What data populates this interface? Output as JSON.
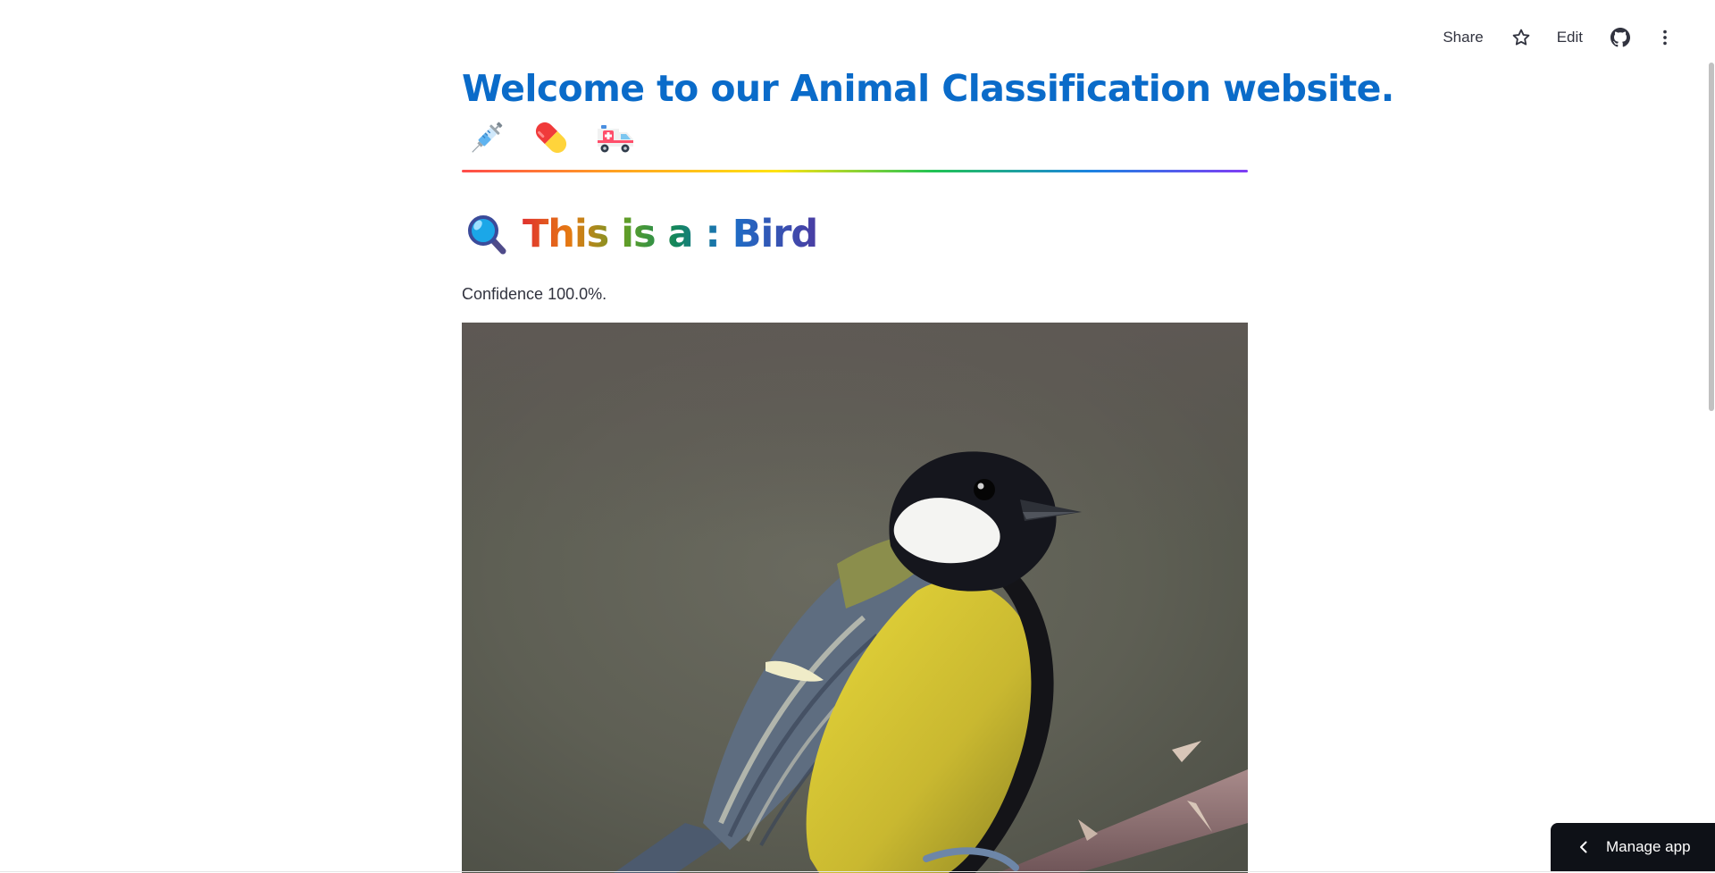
{
  "toolbar": {
    "share_label": "Share",
    "edit_label": "Edit",
    "icons": [
      "star-icon",
      "github-icon",
      "more-vertical-icon"
    ]
  },
  "main": {
    "title": "Welcome to our Animal Classification website.",
    "emojis": [
      "syringe-icon",
      "pill-icon",
      "ambulance-icon"
    ],
    "result_prefix_icon": "magnifier-icon",
    "result_text": "This is a : Bird",
    "confidence": "Confidence 100.0%.",
    "image_subject": "bird-photo"
  },
  "footer": {
    "manage_app_label": "Manage app",
    "manage_app_icon": "chevron-left-icon"
  },
  "colors": {
    "title": "#0a6bc9",
    "manage_app_bg": "#0e1117",
    "divider_gradient": [
      "#ff4b4b",
      "#ffa421",
      "#ffe312",
      "#21c354",
      "#1c83e1",
      "#803df5"
    ]
  }
}
